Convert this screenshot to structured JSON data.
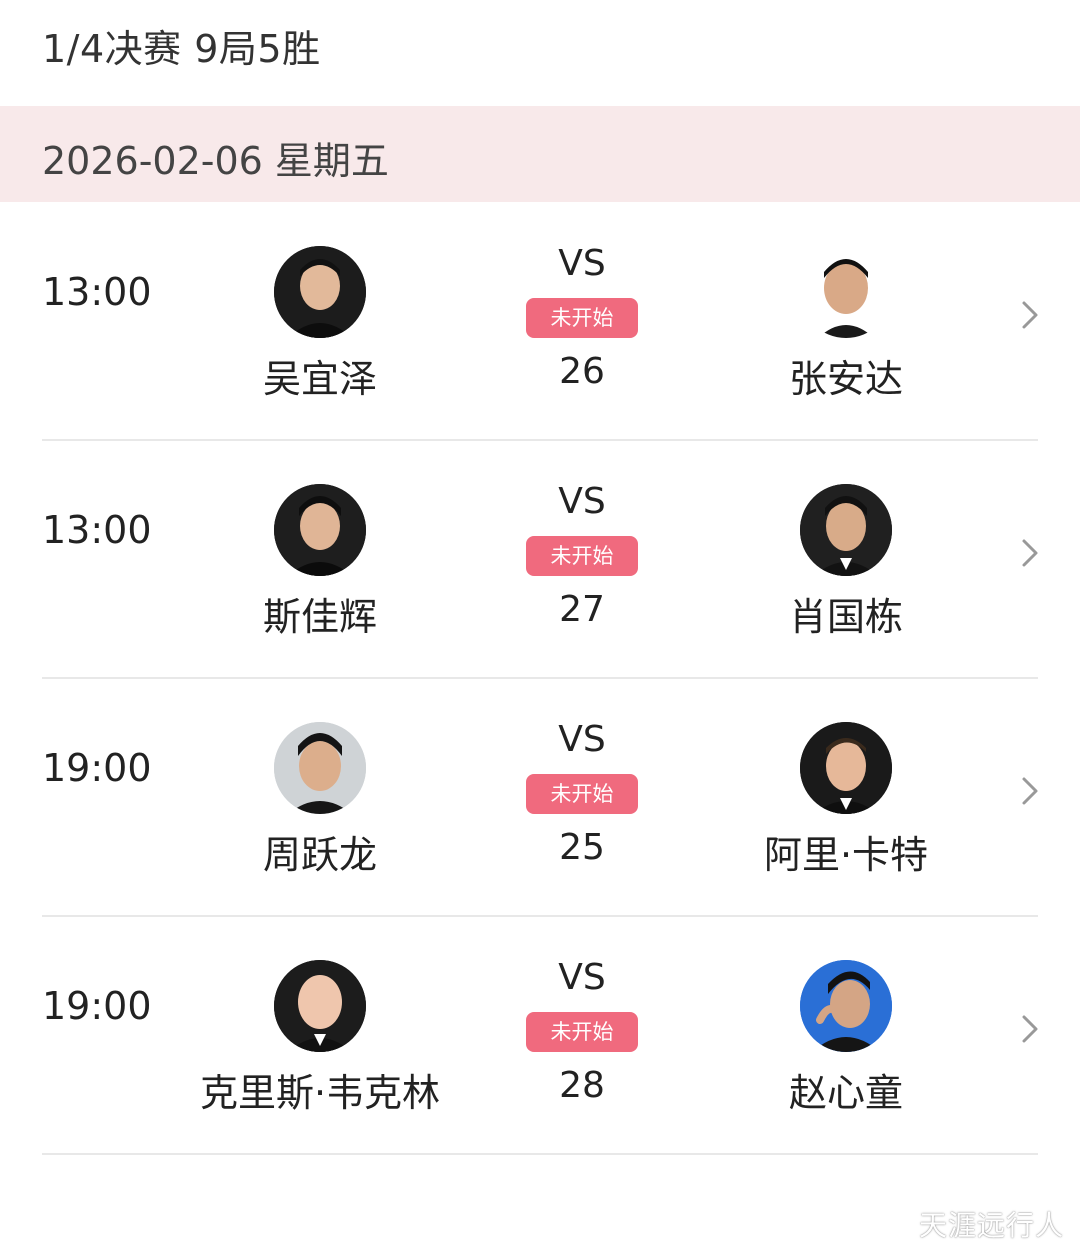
{
  "header": {
    "round_title": "1/4决赛 9局5胜"
  },
  "date_band": {
    "date": "2026-02-06 星期五"
  },
  "matches": [
    {
      "time": "13:00",
      "home": {
        "name": "吴宜泽",
        "avatar_icon": "player-avatar-photo"
      },
      "away": {
        "name": "张安达",
        "avatar_icon": "player-avatar-photo"
      },
      "vs": "VS",
      "status": "未开始",
      "match_no": "26"
    },
    {
      "time": "13:00",
      "home": {
        "name": "斯佳辉",
        "avatar_icon": "player-avatar-photo"
      },
      "away": {
        "name": "肖国栋",
        "avatar_icon": "player-avatar-photo"
      },
      "vs": "VS",
      "status": "未开始",
      "match_no": "27"
    },
    {
      "time": "19:00",
      "home": {
        "name": "周跃龙",
        "avatar_icon": "player-avatar-photo"
      },
      "away": {
        "name": "阿里·卡特",
        "avatar_icon": "player-avatar-photo"
      },
      "vs": "VS",
      "status": "未开始",
      "match_no": "25"
    },
    {
      "time": "19:00",
      "home": {
        "name": "克里斯·韦克林",
        "avatar_icon": "player-avatar-photo"
      },
      "away": {
        "name": "赵心童",
        "avatar_icon": "player-avatar-photo"
      },
      "vs": "VS",
      "status": "未开始",
      "match_no": "28"
    }
  ],
  "watermark": "天涯远行人",
  "colors": {
    "date_band_bg": "#f8e9ea",
    "status_badge_bg": "#f06a7e",
    "divider": "#e8e8e8"
  }
}
